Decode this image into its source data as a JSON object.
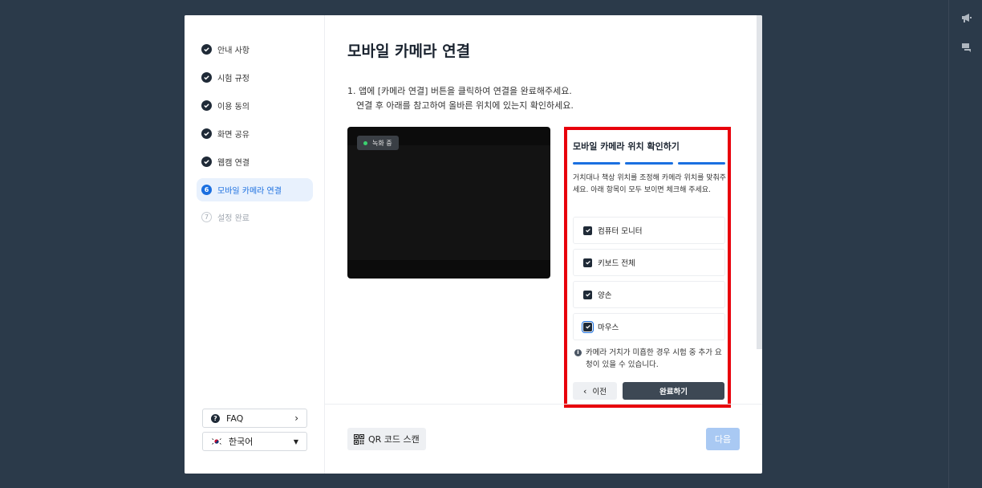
{
  "nav": {
    "steps": [
      {
        "label": "안내 사항",
        "state": "done"
      },
      {
        "label": "시험 규정",
        "state": "done"
      },
      {
        "label": "이용 동의",
        "state": "done"
      },
      {
        "label": "화면 공유",
        "state": "done"
      },
      {
        "label": "웹캠 연결",
        "state": "done"
      },
      {
        "label": "모바일 카메라 연결",
        "state": "active",
        "number": "6"
      },
      {
        "label": "설정 완료",
        "state": "pending",
        "number": "7"
      }
    ],
    "faq_label": "FAQ",
    "language": "한국어"
  },
  "main": {
    "title": "모바일 카메라 연결",
    "instruction_line1": "1. 앱에 [카메라 연결] 버튼을 클릭하여 연결을 완료해주세요.",
    "instruction_line2": "연결 후 아래를 참고하여 올바른 위치에 있는지 확인하세요.",
    "recording_label": "녹화 중",
    "panel": {
      "title": "모바일 카메라 위치 확인하기",
      "description": "거치대나 책상 위치를 조정해 카메라 위치를 맞춰주세요. 아래 항목이 모두 보이면 체크해 주세요.",
      "items": [
        {
          "label": "컴퓨터 모니터",
          "checked": true
        },
        {
          "label": "키보드 전체",
          "checked": true
        },
        {
          "label": "양손",
          "checked": true
        },
        {
          "label": "마우스",
          "checked": true
        }
      ],
      "note": "카메라 거치가 미흡한 경우 시험 중 추가 요청이 있을 수 있습니다.",
      "prev_label": "이전",
      "done_label": "완료하기"
    },
    "qr_label": "QR 코드 스캔",
    "next_label": "다음"
  },
  "colors": {
    "accent": "#1a6fe0",
    "highlight_border": "#e8000b",
    "dark": "#1f2a37"
  }
}
